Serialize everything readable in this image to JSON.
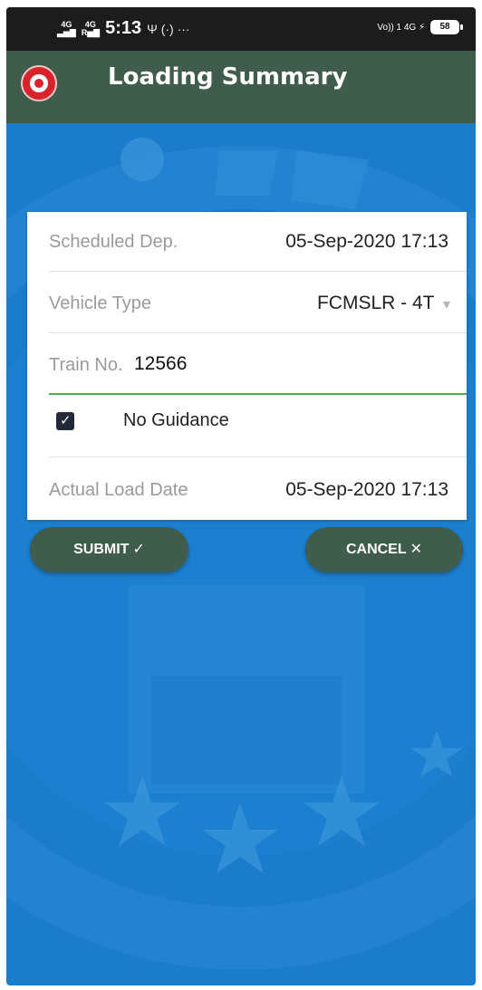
{
  "status_bar": {
    "sig1_top": "4G",
    "sig1_bottom": "▃▅▇",
    "sig2_top": "4G",
    "sig2_bottom": "R▅▇",
    "time": "5:13",
    "misc_icons": "Ψ (·) ···",
    "right_text": "Vo)) 1 4G ⚡",
    "battery": "58"
  },
  "app_bar": {
    "title": "Loading Summary",
    "logo_icon": "indian-railways-logo"
  },
  "form": {
    "scheduled_dep": {
      "label": "Scheduled Dep.",
      "value": "05-Sep-2020 17:13"
    },
    "vehicle_type": {
      "label": "Vehicle Type",
      "value": "FCMSLR - 4T",
      "dropdown_icon": "▾"
    },
    "train_no": {
      "label": "Train No.",
      "value": "12566"
    },
    "no_guidance": {
      "label": "No Guidance",
      "checked": true,
      "check_glyph": "✓"
    },
    "actual_load_date": {
      "label": "Actual Load Date",
      "value": "05-Sep-2020 17:13"
    }
  },
  "buttons": {
    "submit": {
      "label": "SUBMIT",
      "icon": "✓"
    },
    "cancel": {
      "label": "CANCEL",
      "icon": "✕"
    }
  },
  "colors": {
    "app_bar": "#3f5c4c",
    "background": "#1b7ccc",
    "accent_line": "#4caf50",
    "checkbox": "#23283a"
  }
}
